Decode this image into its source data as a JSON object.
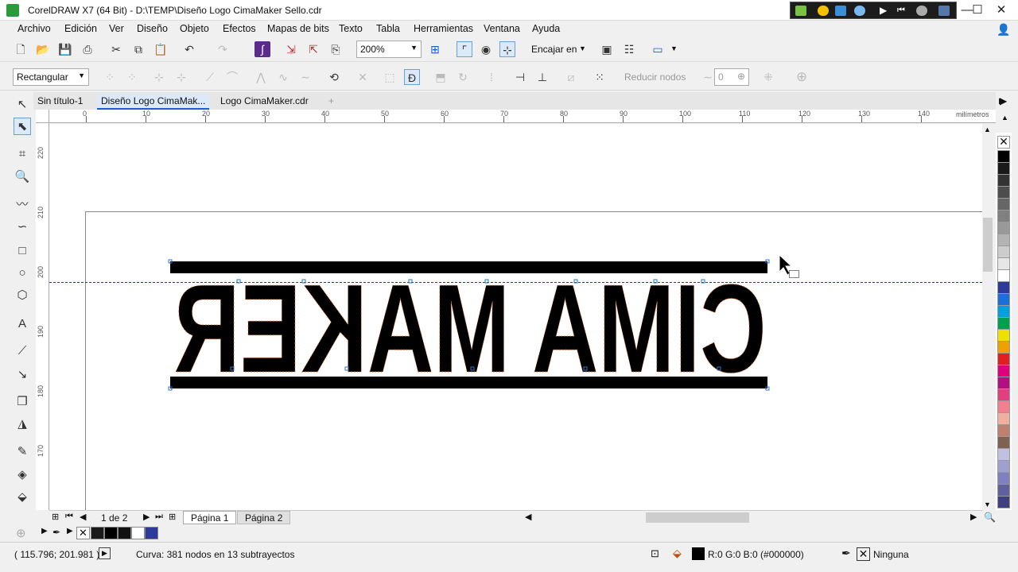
{
  "window": {
    "title": "CorelDRAW X7 (64 Bit) - D:\\TEMP\\Diseño Logo CimaMaker Sello.cdr"
  },
  "menu": [
    "Archivo",
    "Edición",
    "Ver",
    "Diseño",
    "Objeto",
    "Efectos",
    "Mapas de bits",
    "Texto",
    "Tabla",
    "Herramientas",
    "Ventana",
    "Ayuda"
  ],
  "toolbar": {
    "zoom": "200%",
    "snap": "Encajar en"
  },
  "propertybar": {
    "shape_mode": "Rectangular",
    "reduce_nodes": "Reducir nodos",
    "smoothing": "0"
  },
  "doc_tabs": [
    "Sin título-1",
    "Diseño Logo CimaMak...",
    "Logo CimaMaker.cdr"
  ],
  "ruler": {
    "unit": "milímetros",
    "h_labels": [
      "0",
      "10",
      "20",
      "30",
      "40",
      "50",
      "60",
      "70",
      "80",
      "90",
      "100",
      "110",
      "120",
      "130",
      "140"
    ],
    "v_labels": [
      "220",
      "210",
      "200",
      "190",
      "180",
      "170"
    ]
  },
  "canvas": {
    "logo_text": "CIMA MAKER"
  },
  "pagebar": {
    "page_count": "1 de 2",
    "pages": [
      "Página 1",
      "Página 2"
    ]
  },
  "status": {
    "coords": "( 115.796; 201.981 )",
    "info": "Curva: 381 nodos en 13 subtrayectos",
    "fill": "R:0 G:0 B:0 (#000000)",
    "outline": "Ninguna"
  },
  "colors": {
    "accent": "#1f5bd1",
    "node_orange": "#e06010",
    "guide": "#1a3ab0"
  },
  "palette": [
    "#000000",
    "#1a1a1a",
    "#333333",
    "#4d4d4d",
    "#666666",
    "#808080",
    "#999999",
    "#b3b3b3",
    "#cccccc",
    "#e6e6e6",
    "#ffffff",
    "#2d3a9a",
    "#1b6fd8",
    "#00a0e0",
    "#00a050",
    "#f0e000",
    "#f0a000",
    "#e02020",
    "#e0007a",
    "#b01080",
    "#e04080",
    "#f08090",
    "#f0b0a0",
    "#c08070",
    "#806050",
    "#c0c0e0",
    "#a0a0d0",
    "#8080c0",
    "#6060a0",
    "#404080"
  ]
}
